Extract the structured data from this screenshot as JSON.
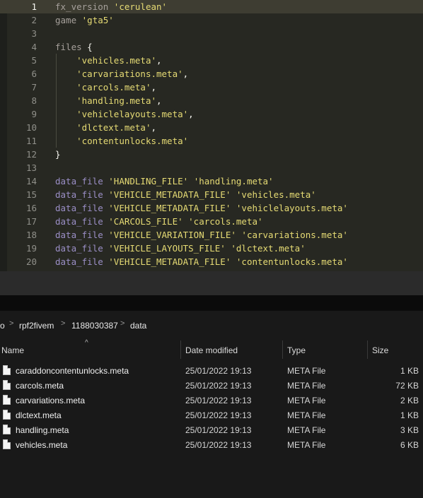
{
  "editor": {
    "lines": [
      {
        "n": "1",
        "tokens": [
          {
            "t": "fx_version",
            "c": "kw"
          },
          {
            "t": " ",
            "c": "plain"
          },
          {
            "t": "'cerulean'",
            "c": "str"
          }
        ]
      },
      {
        "n": "2",
        "tokens": [
          {
            "t": "game",
            "c": "kw"
          },
          {
            "t": " ",
            "c": "plain"
          },
          {
            "t": "'gta5'",
            "c": "str"
          }
        ]
      },
      {
        "n": "3",
        "tokens": []
      },
      {
        "n": "4",
        "tokens": [
          {
            "t": "files",
            "c": "kw"
          },
          {
            "t": " {",
            "c": "plain"
          }
        ]
      },
      {
        "n": "5",
        "tokens": [
          {
            "t": "    ",
            "c": "plain"
          },
          {
            "t": "'vehicles.meta'",
            "c": "str"
          },
          {
            "t": ",",
            "c": "plain"
          }
        ]
      },
      {
        "n": "6",
        "tokens": [
          {
            "t": "    ",
            "c": "plain"
          },
          {
            "t": "'carvariations.meta'",
            "c": "str"
          },
          {
            "t": ",",
            "c": "plain"
          }
        ]
      },
      {
        "n": "7",
        "tokens": [
          {
            "t": "    ",
            "c": "plain"
          },
          {
            "t": "'carcols.meta'",
            "c": "str"
          },
          {
            "t": ",",
            "c": "plain"
          }
        ]
      },
      {
        "n": "8",
        "tokens": [
          {
            "t": "    ",
            "c": "plain"
          },
          {
            "t": "'handling.meta'",
            "c": "str"
          },
          {
            "t": ",",
            "c": "plain"
          }
        ]
      },
      {
        "n": "9",
        "tokens": [
          {
            "t": "    ",
            "c": "plain"
          },
          {
            "t": "'vehiclelayouts.meta'",
            "c": "str"
          },
          {
            "t": ",",
            "c": "plain"
          }
        ]
      },
      {
        "n": "10",
        "tokens": [
          {
            "t": "    ",
            "c": "plain"
          },
          {
            "t": "'dlctext.meta'",
            "c": "str"
          },
          {
            "t": ",",
            "c": "plain"
          }
        ]
      },
      {
        "n": "11",
        "tokens": [
          {
            "t": "    ",
            "c": "plain"
          },
          {
            "t": "'contentunlocks.meta'",
            "c": "str"
          }
        ]
      },
      {
        "n": "12",
        "tokens": [
          {
            "t": "}",
            "c": "plain"
          }
        ]
      },
      {
        "n": "13",
        "tokens": []
      },
      {
        "n": "14",
        "tokens": [
          {
            "t": "data_file",
            "c": "fn"
          },
          {
            "t": " ",
            "c": "plain"
          },
          {
            "t": "'HANDLING_FILE'",
            "c": "str"
          },
          {
            "t": " ",
            "c": "plain"
          },
          {
            "t": "'handling.meta'",
            "c": "str"
          }
        ]
      },
      {
        "n": "15",
        "tokens": [
          {
            "t": "data_file",
            "c": "fn"
          },
          {
            "t": " ",
            "c": "plain"
          },
          {
            "t": "'VEHICLE_METADATA_FILE'",
            "c": "str"
          },
          {
            "t": " ",
            "c": "plain"
          },
          {
            "t": "'vehicles.meta'",
            "c": "str"
          }
        ]
      },
      {
        "n": "16",
        "tokens": [
          {
            "t": "data_file",
            "c": "fn"
          },
          {
            "t": " ",
            "c": "plain"
          },
          {
            "t": "'VEHICLE_METADATA_FILE'",
            "c": "str"
          },
          {
            "t": " ",
            "c": "plain"
          },
          {
            "t": "'vehiclelayouts.meta'",
            "c": "str"
          }
        ]
      },
      {
        "n": "17",
        "tokens": [
          {
            "t": "data_file",
            "c": "fn"
          },
          {
            "t": " ",
            "c": "plain"
          },
          {
            "t": "'CARCOLS_FILE'",
            "c": "str"
          },
          {
            "t": " ",
            "c": "plain"
          },
          {
            "t": "'carcols.meta'",
            "c": "str"
          }
        ]
      },
      {
        "n": "18",
        "tokens": [
          {
            "t": "data_file",
            "c": "fn"
          },
          {
            "t": " ",
            "c": "plain"
          },
          {
            "t": "'VEHICLE_VARIATION_FILE'",
            "c": "str"
          },
          {
            "t": " ",
            "c": "plain"
          },
          {
            "t": "'carvariations.meta'",
            "c": "str"
          }
        ]
      },
      {
        "n": "19",
        "tokens": [
          {
            "t": "data_file",
            "c": "fn"
          },
          {
            "t": " ",
            "c": "plain"
          },
          {
            "t": "'VEHICLE_LAYOUTS_FILE'",
            "c": "str"
          },
          {
            "t": " ",
            "c": "plain"
          },
          {
            "t": "'dlctext.meta'",
            "c": "str"
          }
        ]
      },
      {
        "n": "20",
        "tokens": [
          {
            "t": "data_file",
            "c": "fn"
          },
          {
            "t": " ",
            "c": "plain"
          },
          {
            "t": "'VEHICLE_METADATA_FILE'",
            "c": "str"
          },
          {
            "t": " ",
            "c": "plain"
          },
          {
            "t": "'contentunlocks.meta'",
            "c": "str"
          }
        ]
      }
    ],
    "active_line": "1"
  },
  "explorer": {
    "breadcrumb": {
      "separator": ">",
      "items": [
        "o",
        "rpf2fivem",
        "1188030387",
        "data"
      ]
    },
    "columns": {
      "name": "Name",
      "date": "Date modified",
      "type": "Type",
      "size": "Size"
    },
    "sort_indicator": "^",
    "files": [
      {
        "name": "caraddoncontentunlocks.meta",
        "date": "25/01/2022 19:13",
        "type": "META File",
        "size": "1 KB"
      },
      {
        "name": "carcols.meta",
        "date": "25/01/2022 19:13",
        "type": "META File",
        "size": "72 KB"
      },
      {
        "name": "carvariations.meta",
        "date": "25/01/2022 19:13",
        "type": "META File",
        "size": "2 KB"
      },
      {
        "name": "dlctext.meta",
        "date": "25/01/2022 19:13",
        "type": "META File",
        "size": "1 KB"
      },
      {
        "name": "handling.meta",
        "date": "25/01/2022 19:13",
        "type": "META File",
        "size": "3 KB"
      },
      {
        "name": "vehicles.meta",
        "date": "25/01/2022 19:13",
        "type": "META File",
        "size": "6 KB"
      }
    ]
  }
}
